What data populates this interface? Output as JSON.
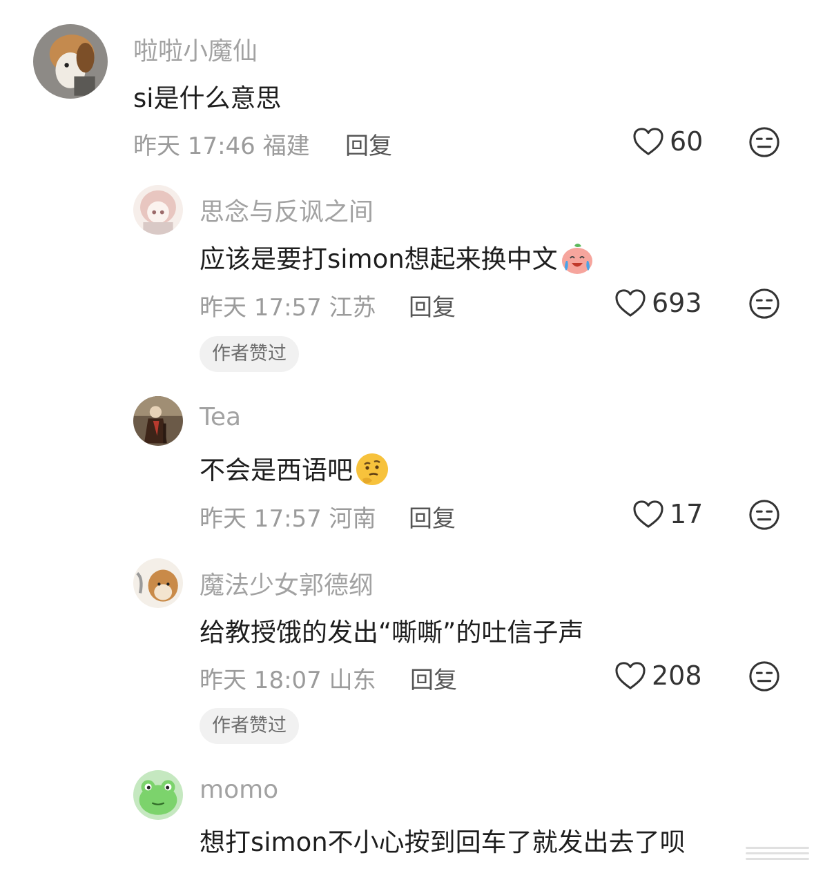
{
  "comments": [
    {
      "username": "啦啦小魔仙",
      "content": "si是什么意思",
      "time": "昨天 17:46",
      "location": "福建",
      "reply_label": "回复",
      "likes": "60",
      "avatar": "beagle-dog-avatar"
    },
    {
      "username": "思念与反讽之间",
      "content": "应该是要打simon想起来换中文",
      "emoji": "laughing-crying-peach-emoji",
      "time": "昨天 17:57",
      "location": "江苏",
      "reply_label": "回复",
      "likes": "693",
      "badge": "作者赞过",
      "avatar": "anime-girl-avatar"
    },
    {
      "username": "Tea",
      "content": "不会是西语吧",
      "emoji": "thinking-face-emoji",
      "time": "昨天 17:57",
      "location": "河南",
      "reply_label": "回复",
      "likes": "17",
      "avatar": "painting-portrait-avatar"
    },
    {
      "username": "魔法少女郭德纲",
      "content": "给教授饿的发出“嘶嘶”的吐信子声",
      "time": "昨天 18:07",
      "location": "山东",
      "reply_label": "回复",
      "likes": "208",
      "badge": "作者赞过",
      "avatar": "shiba-dog-avatar"
    },
    {
      "username": "momo",
      "content": "想打simon不小心按到回车了就发出去了呗",
      "avatar": "green-frog-avatar"
    }
  ],
  "icons": {
    "like": "heart-outline-icon",
    "dislike": "unamused-face-icon"
  },
  "colors": {
    "username": "#a2a2a2",
    "content": "#1e1e1e",
    "meta": "#9b9b9b",
    "badge_bg": "#f1f1f1"
  }
}
